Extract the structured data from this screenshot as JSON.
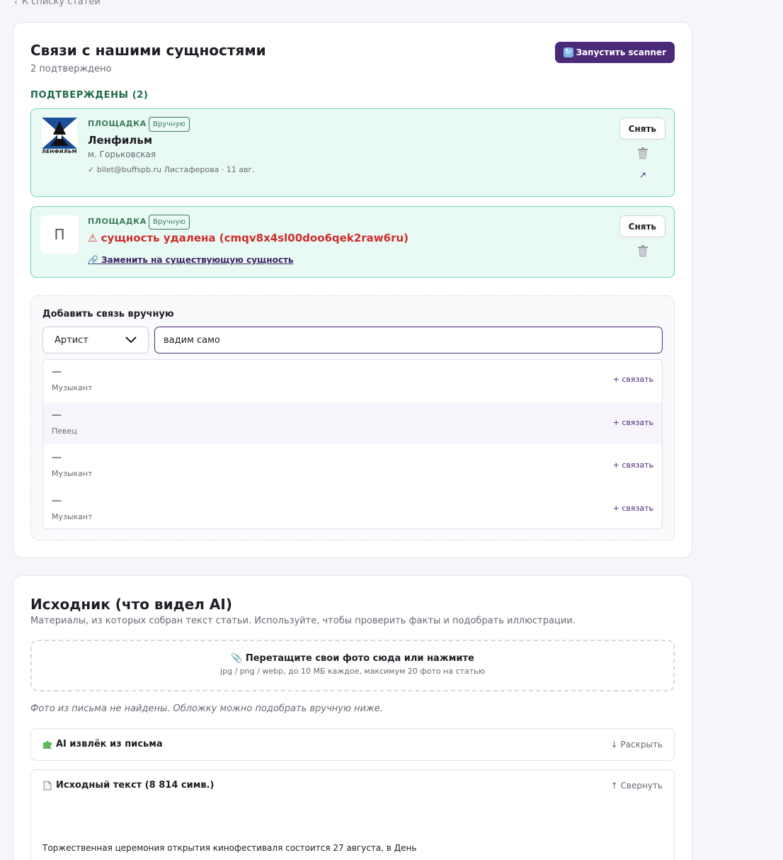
{
  "back_link": "К списку статей",
  "entities_card": {
    "title": "Связи с нашими сущностями",
    "subtitle": "2 подтверждено",
    "scan_button": "Запустить scanner",
    "section_title": "ПОДТВЕРЖДЕНЫ (2)",
    "entities": [
      {
        "kind": "ПЛОЩАДКА",
        "tag": "Вручную",
        "name": "Ленфильм",
        "logo_text": "ЛЕНФИЛЬМ",
        "meta": "м. Горьковская",
        "verified": "✓ bilet@buffspb.ru Листаферова · 11 авг.",
        "remove_label": "Снять"
      },
      {
        "kind": "ПЛОЩАДКА",
        "tag": "Вручную",
        "placeholder_letter": "П",
        "name": "⚠ сущность удалена (cmqv8x4sl00doo6qek2raw6ru)",
        "replace_link": "🔗 Заменить на существующую сущность",
        "remove_label": "Снять"
      }
    ],
    "add_manual": {
      "title": "Добавить связь вручную",
      "type_selected": "Артист",
      "search_value": "вадим само",
      "results": [
        {
          "name": "—",
          "role": "Музыкант",
          "action": "+ связать"
        },
        {
          "name": "—",
          "role": "Певец",
          "action": "+ связать"
        },
        {
          "name": "—",
          "role": "Музыкант",
          "action": "+ связать"
        },
        {
          "name": "—",
          "role": "Музыкант",
          "action": "+ связать"
        }
      ]
    }
  },
  "source_card": {
    "title": "Исходник (что видел AI)",
    "subtitle": "Материалы, из которых собран текст статьи. Используйте, чтобы проверить факты и подобрать иллюстрации.",
    "dropzone_title": "📎 Перетащите свои фото сюда или нажмите",
    "dropzone_hint": "jpg / png / webp, до 10 МБ каждое, максимум 20 фото на статью",
    "no_photos_note": "Фото из письма не найдены. Обложку можно подобрать вручную ниже.",
    "ai_extract": {
      "title": "AI извлёк из письма",
      "toggle": "↓ Раскрыть",
      "icon": "puzzle-icon"
    },
    "source_text": {
      "title": "Исходный текст (8 814 симв.)",
      "toggle": "↑ Свернуть",
      "icon": "document-icon",
      "first_line": "Торжественная церемония открытия кинофестиваля состоится 27 августа, в День"
    }
  },
  "colors": {
    "accent": "#4b2a7a",
    "confirmed_bg": "#e8faf3",
    "confirmed_border": "#72d8b0",
    "deleted_red": "#d12b2b"
  }
}
